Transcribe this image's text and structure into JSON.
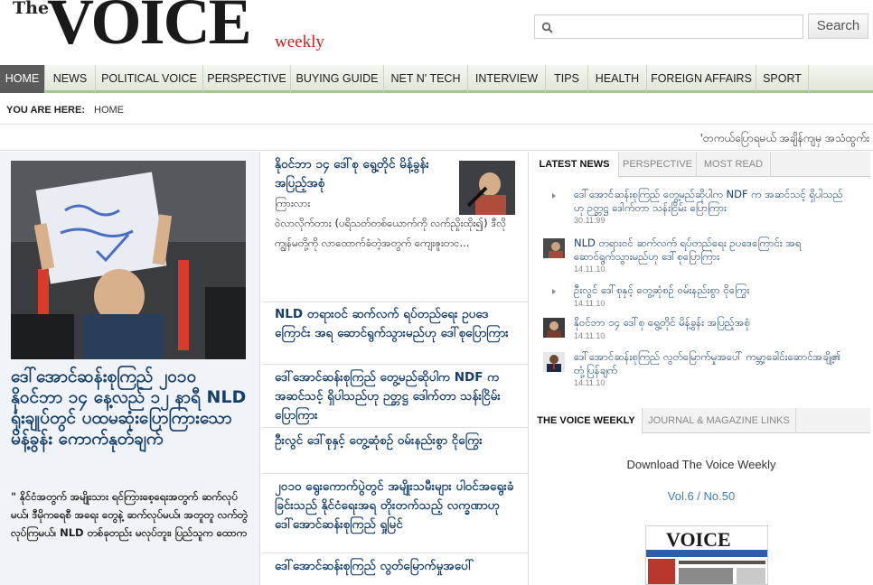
{
  "header": {
    "logo_the": "The",
    "logo_voice": "VOICE",
    "logo_weekly": "weekly",
    "search_placeholder": "",
    "search_button": "Search"
  },
  "nav": {
    "items": [
      "HOME",
      "NEWS",
      "POLITICAL VOICE",
      "PERSPECTIVE",
      "BUYING GUIDE",
      "NET N' TECH",
      "INTERVIEW",
      "TIPS",
      "HEALTH",
      "FOREIGN AFFAIRS",
      "SPORT"
    ],
    "active": "HOME"
  },
  "breadcrumb": {
    "label": "YOU ARE HERE:",
    "current": "HOME"
  },
  "ticker": {
    "text": "'တကယ်ပြောရမယ် အချိန်ကျမှ အသံထွက်း"
  },
  "feature": {
    "title": "ဒေါ်အောင်ဆန်းစုကြည် ၂၀၁၀ နိုဝင်ဘာ ၁၄ နေ့လည် ၁၂ နာရီ NLD ရုံးချုပ်တွင် ပထမဆုံးပြောကြားသော မိန့်ခွန်း ကောက်နုတ်ချက်",
    "text": "\" နိုင်ငံအတွက် အမျိုးသား ရင်ကြားစေ့ရေးအတွက် ဆက်လုပ်မယ်၊ ဒီမိုကရေစီ အရေး တွေနဲ့ ဆက်လုပ်မယ်၊ အတူတူ လက်တွဲလုပ်ကြမယ်၊ NLD တစ်ခုတည်း မလုပ်ဘူး၊ ပြည်သူက ထောက"
  },
  "middle": {
    "items": [
      {
        "title": "နိုဝင်ဘာ ၁၄ ဒေါ်စု ရွေ့တိုင် မိန့်ခွန်း အပြည့်အစုံ",
        "tag": "ကြားလား",
        "body": "ဝဲလာလိုက်တား (ပရိသတ်တစ်ယောက်ကို လက်ညှိုးထိုး၍) ဒီလို ကျွန်မတို့ကို လာထောက်ခံတဲ့အတွက် ကျေးဇူးတင..."
      },
      {
        "title": "NLD တရားဝင် ဆက်လက် ရပ်တည်ရေး ဥပဒေကြောင်း အရ ဆောင်ရွက်သွားမည်ဟု ဒေါ်စုပြောကြား"
      },
      {
        "title": "ဒေါ်အောင်ဆန်းစုကြည် တွေ့မည်ဆိုပါက NDF က အဆင်သင့် ရှိပါသည်ဟု ဉတ္တဋ္ဌ ဒေါက်တာ သန်းငြိမ်း ပြောကြား"
      },
      {
        "title": "ဦးလွင် ဒေါ်စုနှင့် တွေ့ဆုံစဉ် ဝမ်းနည်းစွာ ငိုကြွေး"
      },
      {
        "title": "၂၀၁၀ ရွေးကောက်ပွဲတွင် အမျိုးသမီးများ ပါဝင်အရွေးခံခြင်းသည် နိုင်ငံရေးအရ တိုးတက်သည့် လက္ခဏာဟု ဒေါ်အောင်ဆန်းစုကြည် ရှုမြင်"
      },
      {
        "title": "ဒေါ်အောင်ဆန်းစုကြည် လွတ်မြောက်မှုအပေါ်"
      }
    ]
  },
  "latest": {
    "tabs": [
      "LATEST NEWS",
      "PERSPECTIVE",
      "MOST READ"
    ],
    "items": [
      {
        "headline": "ဒေါ်အောင်ဆန်းစုကြည် တွေ့မည်ဆိုပါက NDF က အဆင်သင့် ရှိပါသည်ဟု ဉတ္တဋ္ဌ ဒေါက်တာ သန်းငြိမ်း ပြောကြား",
        "date": "30.11.99"
      },
      {
        "headline": "NLD တရားဝင် ဆက်လက် ရပ်တည်ရေး ဥပဒေကြောင်း အရ ဆောင်ရွက်သွားမည်ဟု ဒေါ်စုပြောကြား",
        "date": "14.11.10"
      },
      {
        "headline": "ဦးလွင် ဒေါ်စုနှင့် တွေ့ဆုံစဉ် ဝမ်းနည်းစွာ ငိုကြွေး",
        "date": "14.11.10"
      },
      {
        "headline": "နိုဝင်ဘာ ၁၄ ဒေါ်စု ရွေ့တိုင် မိန့်ခွန်း အပြည့်အစုံ",
        "date": "14.11.10"
      },
      {
        "headline": "ဒေါ်အောင်ဆန်းစုကြည် လွတ်မြောက်မှုအပေါ် ကမ္ဘာ့ခေါင်းဆောင်အချို့၏ တုံ့ပြန်ချက်",
        "date": "14.11.10"
      }
    ]
  },
  "weekly": {
    "tabs": [
      "THE VOICE WEEKLY",
      "JOURNAL & MAGAZINE LINKS"
    ],
    "download_label": "Download The Voice Weekly",
    "issue": "Vol.6 / No.50",
    "cover_title": "VOICE"
  },
  "colors": {
    "link": "#16406b",
    "nav_active": "#5b5b5b",
    "nav_border": "#a4c68f",
    "logo_accent": "#d11f1f",
    "issue_link": "#3f7fb8"
  }
}
